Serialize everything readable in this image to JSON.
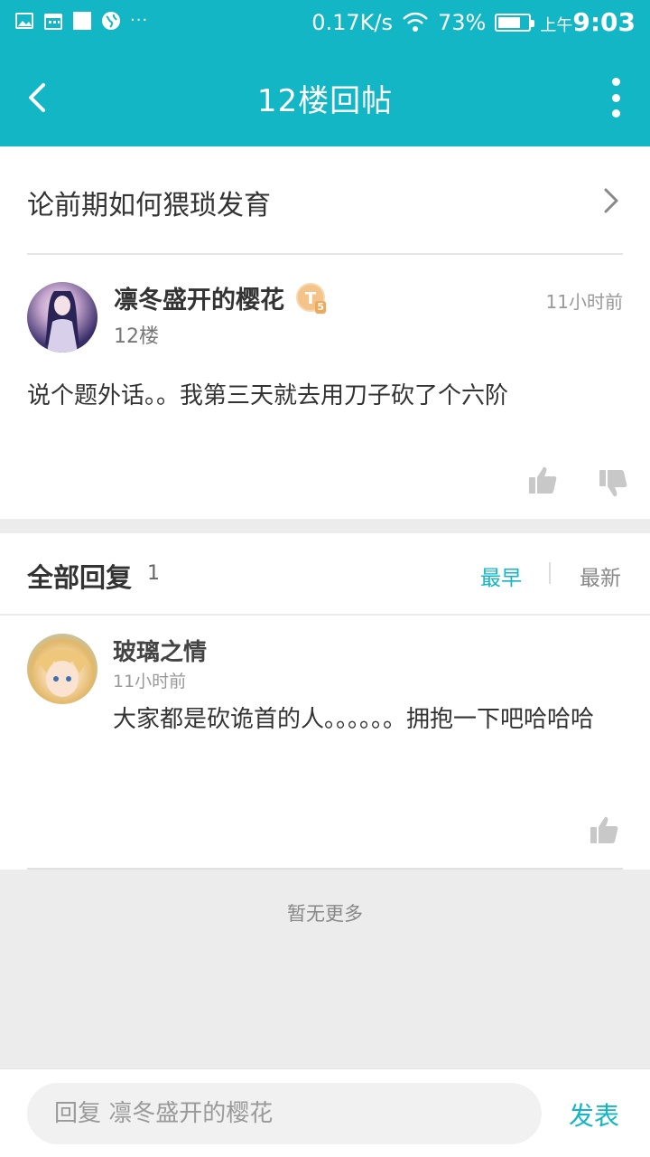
{
  "status_bar": {
    "icons": [
      "image-icon",
      "calendar-icon",
      "square-icon",
      "globe-icon"
    ],
    "more": "···",
    "network_speed": "0.17K/s",
    "battery": "73%",
    "battery_level": 0.73,
    "time_prefix": "上午",
    "time": "9:03"
  },
  "nav": {
    "title": "12楼回帖"
  },
  "topic": {
    "title": "论前期如何猥琐发育"
  },
  "post": {
    "author": "凛冬盛开的樱花",
    "badge": "T",
    "badge_level": "5",
    "floor": "12楼",
    "time": "11小时前",
    "content": "说个题外话。。我第三天就去用刀子砍了个六阶"
  },
  "replies_header": {
    "title": "全部回复",
    "count": "1",
    "sort_earliest": "最早",
    "sort_newest": "最新"
  },
  "replies": [
    {
      "author": "玻璃之情",
      "time": "11小时前",
      "content": "大家都是砍诡首的人。。。。。。拥抱一下吧哈哈哈"
    }
  ],
  "footer": {
    "no_more": "暂无更多"
  },
  "input": {
    "placeholder": "回复 凛冬盛开的樱花",
    "send_label": "发表"
  },
  "colors": {
    "accent": "#13b6c4",
    "background": "#ececec"
  }
}
